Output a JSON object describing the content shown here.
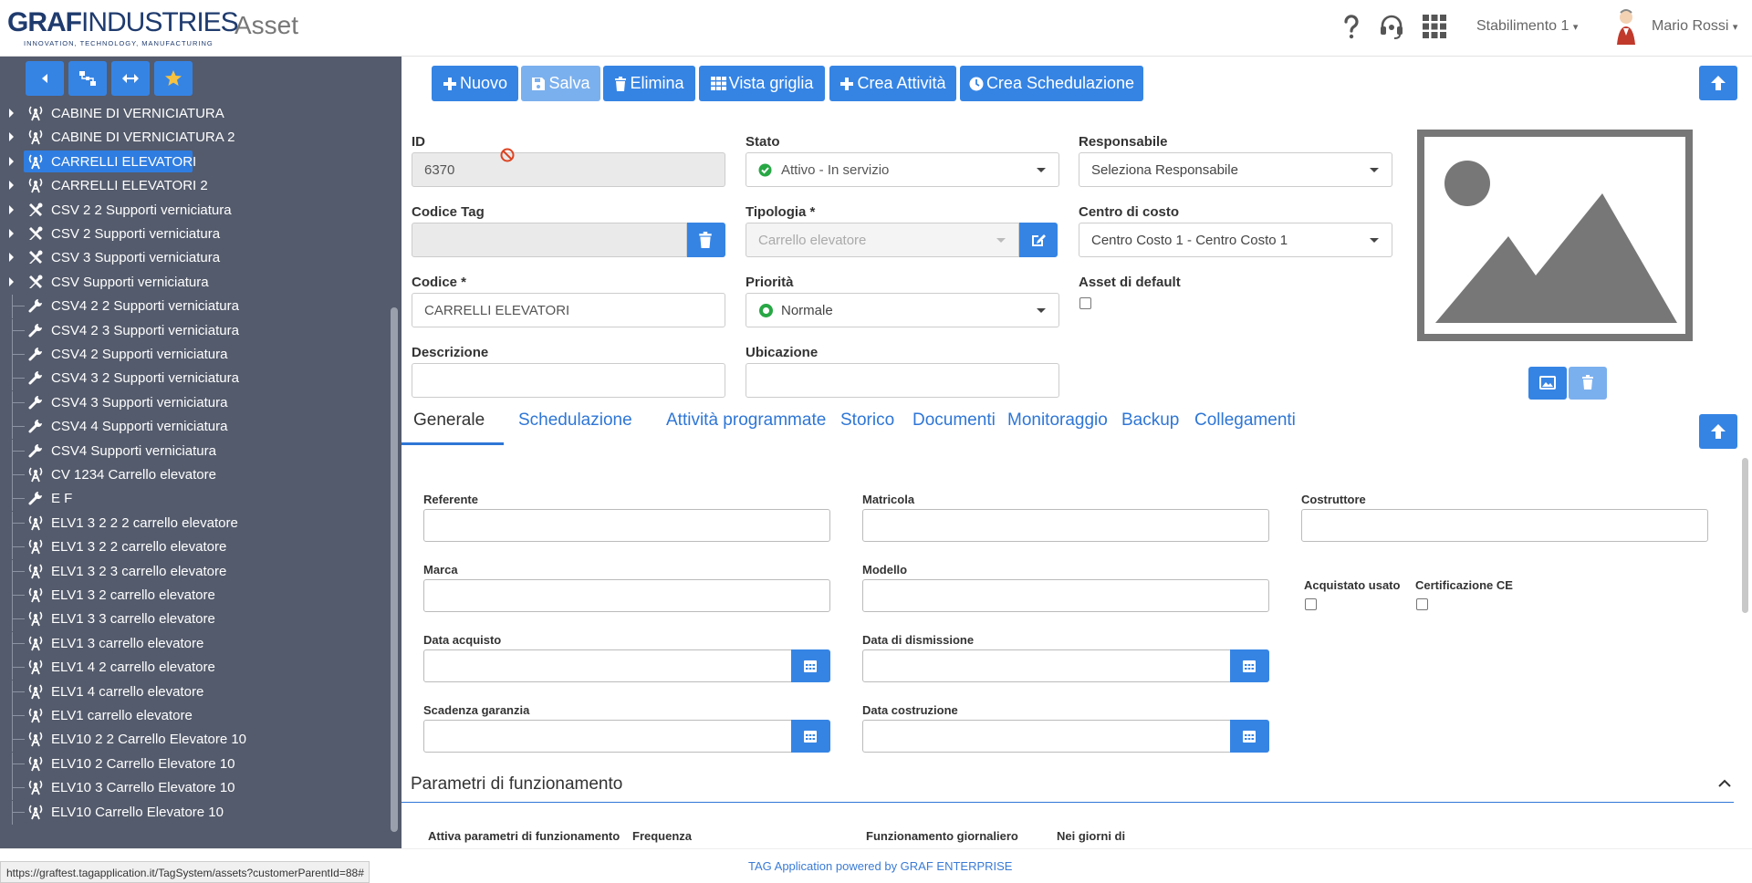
{
  "header": {
    "logo_main_bold": "GRAF",
    "logo_main_thin": "INDUSTRIES",
    "logo_tagline": "INNOVATION, TECHNOLOGY, MANUFACTURING",
    "app_title": "Asset",
    "plant_selector": "Stabilimento 1",
    "user_name": "Mario Rossi",
    "icons": [
      "help-icon",
      "headset-icon",
      "apps-grid-icon"
    ]
  },
  "sidebar": {
    "toolbar_icons": [
      "back-icon",
      "hierarchy-icon",
      "expand-horizontal-icon",
      "star-icon"
    ],
    "tree": [
      {
        "label": "CABINE DI VERNICIATURA",
        "icon": "antenna-icon",
        "expandable": true
      },
      {
        "label": "CABINE DI VERNICIATURA 2",
        "icon": "antenna-icon",
        "expandable": true
      },
      {
        "label": "CARRELLI ELEVATORI",
        "icon": "antenna-icon",
        "expandable": true,
        "selected": true
      },
      {
        "label": "CARRELLI ELEVATORI 2",
        "icon": "antenna-icon",
        "expandable": true
      },
      {
        "label": "CSV 2 2 Supporti verniciatura",
        "icon": "tools-icon",
        "expandable": true
      },
      {
        "label": "CSV 2 Supporti verniciatura",
        "icon": "tools-icon",
        "expandable": true
      },
      {
        "label": "CSV 3 Supporti verniciatura",
        "icon": "tools-icon",
        "expandable": true
      },
      {
        "label": "CSV Supporti verniciatura",
        "icon": "tools-icon",
        "expandable": true
      },
      {
        "label": "CSV4 2 2 Supporti verniciatura",
        "icon": "wrench-icon",
        "expandable": false
      },
      {
        "label": "CSV4 2 3 Supporti verniciatura",
        "icon": "wrench-icon",
        "expandable": false
      },
      {
        "label": "CSV4 2 Supporti verniciatura",
        "icon": "wrench-icon",
        "expandable": false
      },
      {
        "label": "CSV4 3 2 Supporti verniciatura",
        "icon": "wrench-icon",
        "expandable": false
      },
      {
        "label": "CSV4 3 Supporti verniciatura",
        "icon": "wrench-icon",
        "expandable": false
      },
      {
        "label": "CSV4 4 Supporti verniciatura",
        "icon": "wrench-icon",
        "expandable": false
      },
      {
        "label": "CSV4 Supporti verniciatura",
        "icon": "wrench-icon",
        "expandable": false
      },
      {
        "label": "CV 1234 Carrello elevatore",
        "icon": "antenna-icon",
        "expandable": false
      },
      {
        "label": "E F",
        "icon": "wrench-icon",
        "expandable": false
      },
      {
        "label": "ELV1 3 2 2 2 carrello elevatore",
        "icon": "antenna-icon",
        "expandable": false
      },
      {
        "label": "ELV1 3 2 2 carrello elevatore",
        "icon": "antenna-icon",
        "expandable": false
      },
      {
        "label": "ELV1 3 2 3 carrello elevatore",
        "icon": "antenna-icon",
        "expandable": false
      },
      {
        "label": "ELV1 3 2 carrello elevatore",
        "icon": "antenna-icon",
        "expandable": false
      },
      {
        "label": "ELV1 3 3 carrello elevatore",
        "icon": "antenna-icon",
        "expandable": false
      },
      {
        "label": "ELV1 3 carrello elevatore",
        "icon": "antenna-icon",
        "expandable": false
      },
      {
        "label": "ELV1 4 2 carrello elevatore",
        "icon": "antenna-icon",
        "expandable": false
      },
      {
        "label": "ELV1 4 carrello elevatore",
        "icon": "antenna-icon",
        "expandable": false
      },
      {
        "label": "ELV1 carrello elevatore",
        "icon": "antenna-icon",
        "expandable": false
      },
      {
        "label": "ELV10 2 2 Carrello Elevatore 10",
        "icon": "antenna-icon",
        "expandable": false
      },
      {
        "label": "ELV10 2 Carrello Elevatore 10",
        "icon": "antenna-icon",
        "expandable": false
      },
      {
        "label": "ELV10 3 Carrello Elevatore 10",
        "icon": "antenna-icon",
        "expandable": false
      },
      {
        "label": "ELV10 Carrello Elevatore 10",
        "icon": "antenna-icon",
        "expandable": false
      }
    ]
  },
  "toolbar": {
    "nuovo": "Nuovo",
    "salva": "Salva",
    "elimina": "Elimina",
    "vista_griglia": "Vista griglia",
    "crea_attivita": "Crea Attività",
    "crea_schedulazione": "Crea Schedulazione"
  },
  "form": {
    "id_label": "ID",
    "id_value": "6370",
    "stato_label": "Stato",
    "stato_value": "Attivo - In servizio",
    "responsabile_label": "Responsabile",
    "responsabile_value": "Seleziona Responsabile",
    "codice_tag_label": "Codice Tag",
    "codice_tag_value": "",
    "tipologia_label": "Tipologia *",
    "tipologia_value": "Carrello elevatore",
    "centro_costo_label": "Centro di costo",
    "centro_costo_value": "Centro Costo 1 - Centro Costo 1",
    "codice_label": "Codice *",
    "codice_value": "CARRELLI ELEVATORI",
    "priorita_label": "Priorità",
    "priorita_value": "Normale",
    "asset_default_label": "Asset di default",
    "descrizione_label": "Descrizione",
    "descrizione_value": "",
    "ubicazione_label": "Ubicazione",
    "ubicazione_value": ""
  },
  "tabs": [
    {
      "label": "Generale",
      "active": true
    },
    {
      "label": "Schedulazione"
    },
    {
      "label": "Attività programmate"
    },
    {
      "label": "Storico"
    },
    {
      "label": "Documenti"
    },
    {
      "label": "Monitoraggio"
    },
    {
      "label": "Backup"
    },
    {
      "label": "Collegamenti"
    }
  ],
  "generale": {
    "referente": "Referente",
    "matricola": "Matricola",
    "costruttore": "Costruttore",
    "marca": "Marca",
    "modello": "Modello",
    "acquistato_usato": "Acquistato usato",
    "certificazione_ce": "Certificazione CE",
    "data_acquisto": "Data acquisto",
    "data_dismissione": "Data di dismissione",
    "scadenza_garanzia": "Scadenza garanzia",
    "data_costruzione": "Data costruzione"
  },
  "parametri": {
    "title": "Parametri di funzionamento",
    "attiva": "Attiva parametri di funzionamento",
    "frequenza": "Frequenza",
    "funzionamento_giornaliero": "Funzionamento giornaliero",
    "nei_giorni_di": "Nei giorni di"
  },
  "statusbar_url": "https://graftest.tagapplication.it/TagSystem/assets?customerParentId=88#",
  "footer": "TAG Application powered by GRAF ENTERPRISE",
  "colors": {
    "primary": "#3584e4",
    "sidebar_bg": "#545b6c",
    "tab_link": "#2e76d6",
    "status_green": "#28a745"
  }
}
